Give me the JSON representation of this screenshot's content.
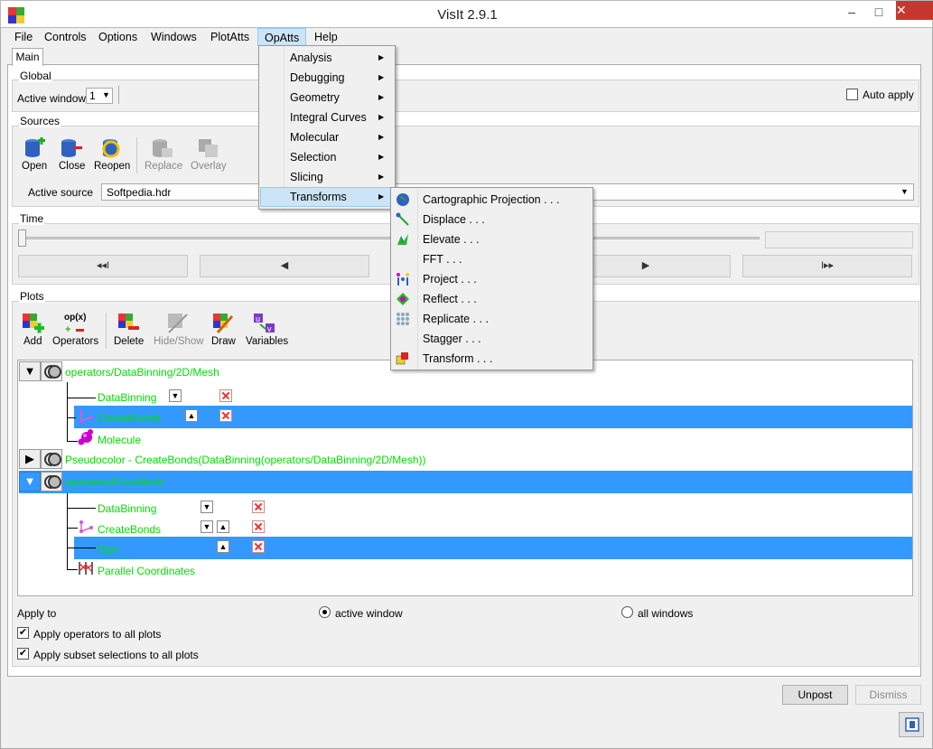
{
  "window": {
    "title": "VisIt 2.9.1",
    "minimize": "–",
    "maximize": "□",
    "close": "✕"
  },
  "menubar": [
    "File",
    "Controls",
    "Options",
    "Windows",
    "PlotAtts",
    "OpAtts",
    "Help"
  ],
  "tabs": {
    "main": "Main"
  },
  "global": {
    "label": "Global",
    "active_window_label": "Active window",
    "active_window_value": "1",
    "auto_apply": "Auto apply"
  },
  "sources": {
    "label": "Sources",
    "buttons": {
      "open": "Open",
      "close": "Close",
      "reopen": "Reopen",
      "replace": "Replace",
      "overlay": "Overlay"
    },
    "active_source_label": "Active source",
    "active_source_value": "Softpedia.hdr"
  },
  "time": {
    "label": "Time",
    "nav": [
      "◂◂I",
      "◀",
      "▶",
      "I▸▸"
    ]
  },
  "plots": {
    "label": "Plots",
    "buttons": {
      "add": "Add",
      "operators_icon": "op(x)",
      "operators": "Operators",
      "delete": "Delete",
      "hide_show": "Hide/Show",
      "draw": "Draw",
      "variables": "Variables"
    },
    "tree": {
      "plot1": "operators/DataBinning/2D/Mesh",
      "plot1_ops": [
        "DataBinning",
        "CreateBonds",
        "Molecule"
      ],
      "plot2": "Pseudocolor - CreateBonds(DataBinning(operators/DataBinning/2D/Mesh))",
      "plot3": "operators/Flux/Mesh",
      "plot3_ops": [
        "DataBinning",
        "CreateBonds",
        "Flux",
        "Parallel Coordinates"
      ]
    }
  },
  "apply": {
    "apply_to": "Apply to",
    "active_window": "active window",
    "all_windows": "all windows",
    "apply_operators": "Apply operators to all plots",
    "apply_subset": "Apply subset selections to all plots"
  },
  "bottom": {
    "unpost": "Unpost",
    "dismiss": "Dismiss"
  },
  "opatts_menu": [
    "Analysis",
    "Debugging",
    "Geometry",
    "Integral Curves",
    "Molecular",
    "Selection",
    "Slicing",
    "Transforms"
  ],
  "transforms_menu": [
    "Cartographic Projection . . .",
    "Displace . . .",
    "Elevate . . .",
    "FFT . . .",
    "Project . . .",
    "Reflect . . .",
    "Replicate . . .",
    "Stagger . . .",
    "Transform . . ."
  ],
  "colors": {
    "selection": "#3399ff",
    "tree_text": "#00e000",
    "menu_highlight": "#cce4f7"
  }
}
